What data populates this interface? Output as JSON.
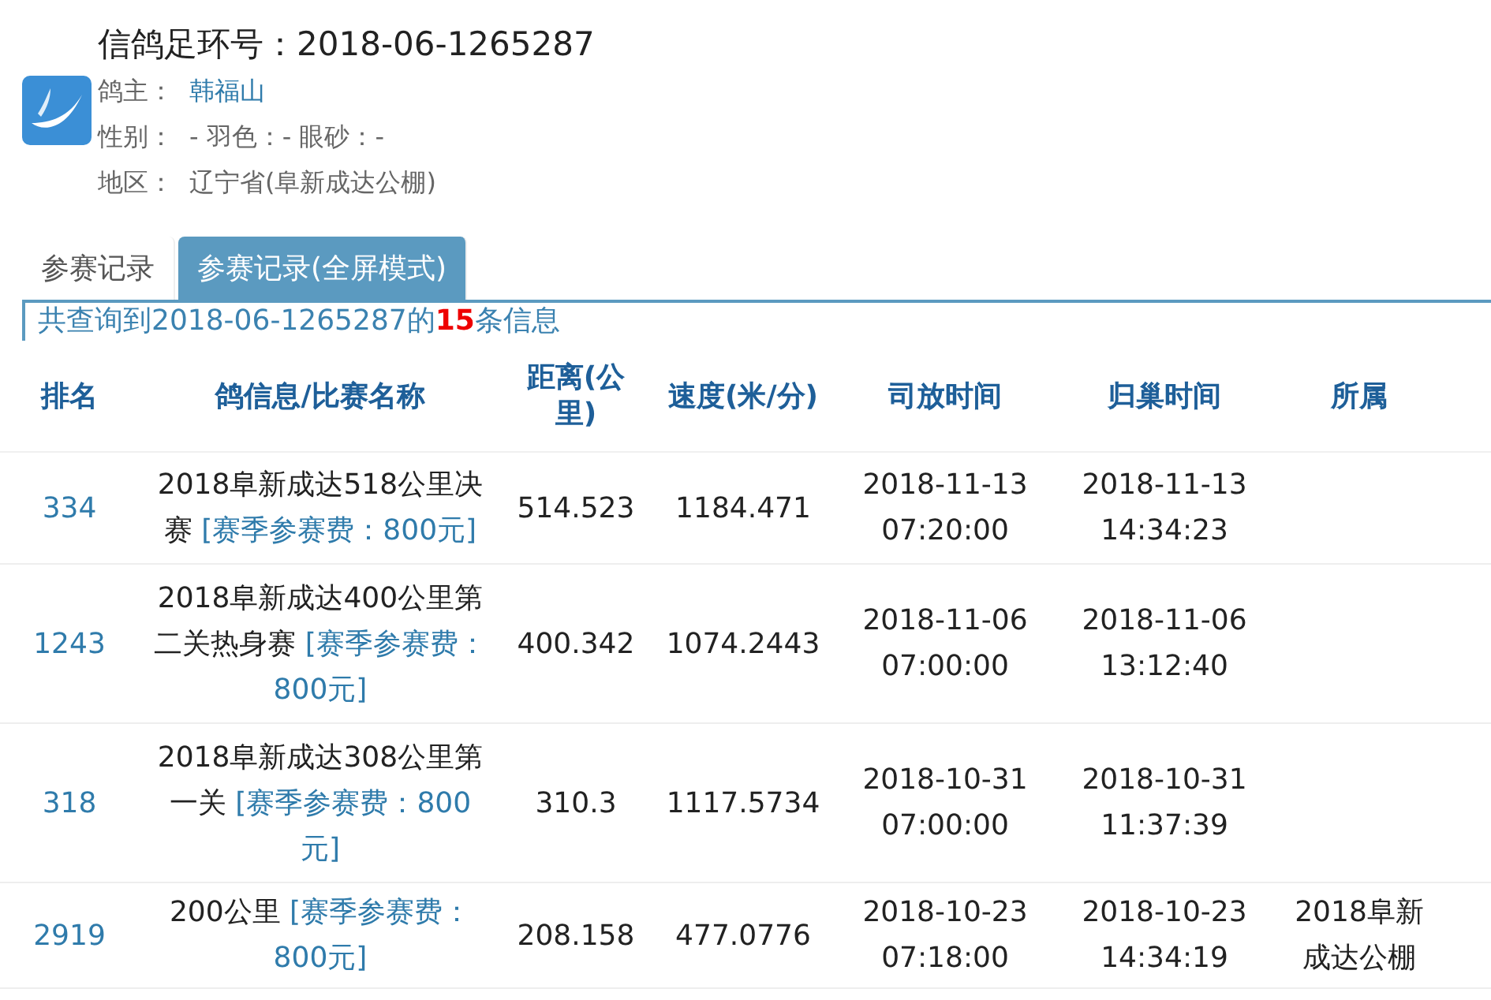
{
  "title": "信鸽足环号：2018-06-1265287",
  "info": [
    {
      "label": "鸽主：",
      "value": "韩福山",
      "kind": "link"
    },
    {
      "label": "性别：",
      "value": "- 羽色：- 眼砂：-",
      "kind": "plain"
    },
    {
      "label": "地区：",
      "value": "辽宁省(阜新成达公棚)",
      "kind": "plain"
    }
  ],
  "tabs": [
    {
      "label": "参赛记录",
      "selected": false
    },
    {
      "label": "参赛记录(全屏模式)",
      "selected": true
    }
  ],
  "summary": "共查询到2018-06-1265287的**15**条信息",
  "table": {
    "columns": [
      "排名",
      "鸽信息/比赛名称",
      "距离(公里)",
      "速度(米/分)",
      "司放时间",
      "归巢时间",
      "所属"
    ],
    "rows": [
      {
        "rank": "334",
        "race": "2018阜新成达518公里决赛",
        "fee": "[赛季参赛费：800元]",
        "distance": "514.523",
        "speed": "1184.471",
        "release": [
          "2018-11-13",
          "07:20:00"
        ],
        "return": [
          "2018-11-13",
          "14:34:23"
        ],
        "belong": ""
      },
      {
        "rank": "1243",
        "race": "2018阜新成达400公里第二关热身赛",
        "fee": "[赛季参赛费：800元]",
        "distance": "400.342",
        "speed": "1074.2443",
        "release": [
          "2018-11-06",
          "07:00:00"
        ],
        "return": [
          "2018-11-06",
          "13:12:40"
        ],
        "belong": ""
      },
      {
        "rank": "318",
        "race": "2018阜新成达308公里第一关",
        "fee": "[赛季参赛费：800元]",
        "distance": "310.3",
        "speed": "1117.5734",
        "release": [
          "2018-10-31",
          "07:00:00"
        ],
        "return": [
          "2018-10-31",
          "11:37:39"
        ],
        "belong": ""
      },
      {
        "rank": "2919",
        "race": "200公里",
        "fee": "[赛季参赛费：800元]",
        "distance": "208.158",
        "speed": "477.0776",
        "release": [
          "2018-10-23",
          "07:18:00"
        ],
        "return": [
          "2018-10-23",
          "14:34:19"
        ],
        "belong": "2018阜新成达公棚"
      }
    ]
  }
}
